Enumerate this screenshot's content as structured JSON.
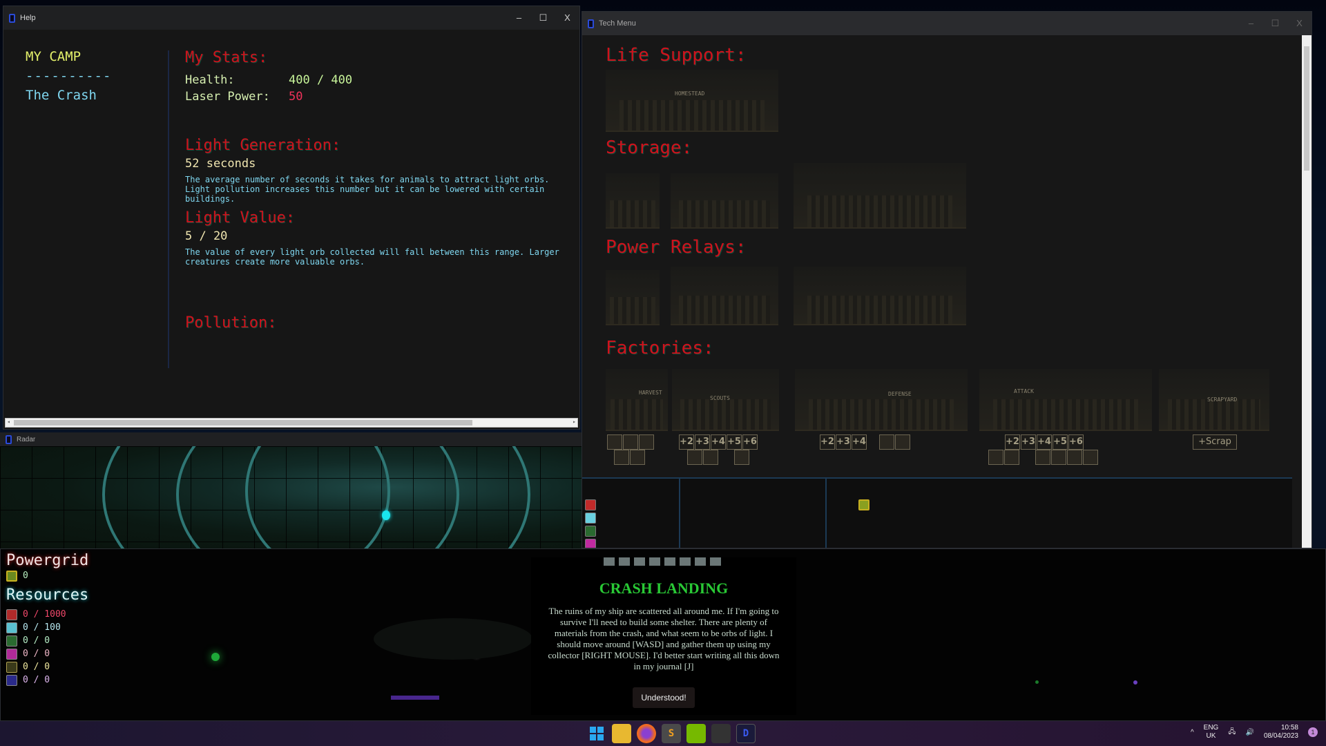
{
  "help_window": {
    "title": "Help",
    "controls": {
      "minimize": "–",
      "maximize": "☐",
      "close": "X"
    },
    "sidebar": {
      "title": "MY CAMP",
      "separator": "----------",
      "link": "The Crash"
    },
    "stats": {
      "heading": "My Stats:",
      "health_label": "Health:",
      "health_value": "400 / 400",
      "laser_label": "Laser Power:",
      "laser_value": "50"
    },
    "light_generation": {
      "heading": "Light Generation:",
      "value": "52 seconds",
      "description": "The average number of seconds it takes for animals to attract light orbs. Light pollution increases this number but it can be lowered with certain buildings."
    },
    "light_value": {
      "heading": "Light Value:",
      "value": "5 / 20",
      "description": "The value of every light orb collected will fall between this range. Larger creatures create more valuable orbs."
    },
    "pollution": {
      "heading": "Pollution:"
    }
  },
  "tech_window": {
    "title": "Tech Menu",
    "controls": {
      "minimize": "–",
      "maximize": "☐",
      "close": "X"
    },
    "sections": {
      "life_support": "Life Support:",
      "storage": "Storage:",
      "power_relays": "Power Relays:",
      "factories": "Factories:"
    },
    "building_labels": {
      "homestead": "HOMESTEAD",
      "harvest": "HARVEST",
      "scouts": "SCOUTS",
      "defense": "DEFENSE",
      "attack": "ATTACK",
      "scrapyard": "SCRAPYARD"
    },
    "upgrades": {
      "scouts": [
        "+2",
        "+3",
        "+4",
        "+5",
        "+6"
      ],
      "defense": [
        "+2",
        "+3",
        "+4"
      ],
      "attack": [
        "+2",
        "+3",
        "+4",
        "+5",
        "+6"
      ],
      "scrapyard": "+Scrap"
    }
  },
  "radar_window": {
    "title": "Radar"
  },
  "hud": {
    "powergrid_label": "Powergrid",
    "powergrid_value": "0",
    "resources_label": "Resources",
    "resources": [
      {
        "icon": "red-block-icon",
        "value": "0 / 1000",
        "color": "#f0486a"
      },
      {
        "icon": "cyan-figure-icon",
        "value": "0 / 100",
        "color": "#b8e8f0"
      },
      {
        "icon": "green-plant-icon",
        "value": "0 / 0",
        "color": "#b8f0c8"
      },
      {
        "icon": "magenta-star-icon",
        "value": "0 / 0",
        "color": "#f0b8c8"
      },
      {
        "icon": "yellow-orbs-icon",
        "value": "0 / 0",
        "color": "#f0e8a0"
      },
      {
        "icon": "blue-cluster-icon",
        "value": "0 / 0",
        "color": "#e0b8f0"
      }
    ]
  },
  "dialog": {
    "title": "CRASH LANDING",
    "text": "The ruins of my ship are scattered all around me. If I'm going to survive I'll need to build some shelter. There are plenty of materials from the crash, and what seem to be orbs of light. I should move around [WASD] and gather them up using my collector [RIGHT MOUSE]. I'd better start writing all this down in my journal [J]",
    "button": "Understood!"
  },
  "taskbar": {
    "apps": [
      "start-icon",
      "file-explorer-icon",
      "firefox-icon",
      "sublime-text-icon",
      "nvidia-icon",
      "game-app-icon",
      "d-app-icon"
    ],
    "tray": {
      "lang": "ENG",
      "region": "UK",
      "time": "10:58",
      "date": "08/04/2023",
      "notifications": "1",
      "chevron": "^"
    }
  }
}
